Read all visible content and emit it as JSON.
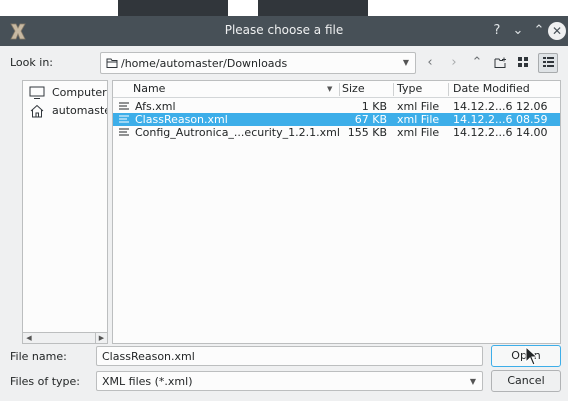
{
  "window": {
    "title": "Please choose a file"
  },
  "titlebar_buttons": {
    "help": "?",
    "minimize": "⌄",
    "maximize": "⌃",
    "close": "✕"
  },
  "toolbar": {
    "look_in_label": "Look in:",
    "path": "/home/automaster/Downloads",
    "buttons": [
      "back-icon",
      "forward-icon",
      "parent-directory-icon",
      "new-folder-icon",
      "list-view-icon",
      "detail-view-icon"
    ]
  },
  "sidebar": {
    "items": [
      {
        "label": "Computer",
        "icon": "computer-icon"
      },
      {
        "label": "automaster",
        "icon": "home-icon"
      }
    ]
  },
  "file_list": {
    "columns": {
      "name": "Name",
      "size": "Size",
      "type": "Type",
      "date": "Date Modified"
    },
    "rows": [
      {
        "name": "Afs.xml",
        "size": "1 KB",
        "type": "xml File",
        "date": "14.12.2...6 12.06",
        "selected": false
      },
      {
        "name": "ClassReason.xml",
        "size": "67 KB",
        "type": "xml File",
        "date": "14.12.2...6 08.59",
        "selected": true
      },
      {
        "name": "Config_Autronica_...ecurity_1.2.1.xml",
        "size": "155 KB",
        "type": "xml File",
        "date": "14.12.2...6 14.00",
        "selected": false
      }
    ]
  },
  "footer": {
    "file_name_label": "File name:",
    "file_name_value": "ClassReason.xml",
    "open_label": "Open",
    "files_of_type_label": "Files of type:",
    "files_of_type_value": "XML files (*.xml)",
    "cancel_label": "Cancel"
  },
  "colors": {
    "titlebar": "#475057",
    "selection": "#3daee9",
    "dialog_bg": "#eff0f1"
  }
}
